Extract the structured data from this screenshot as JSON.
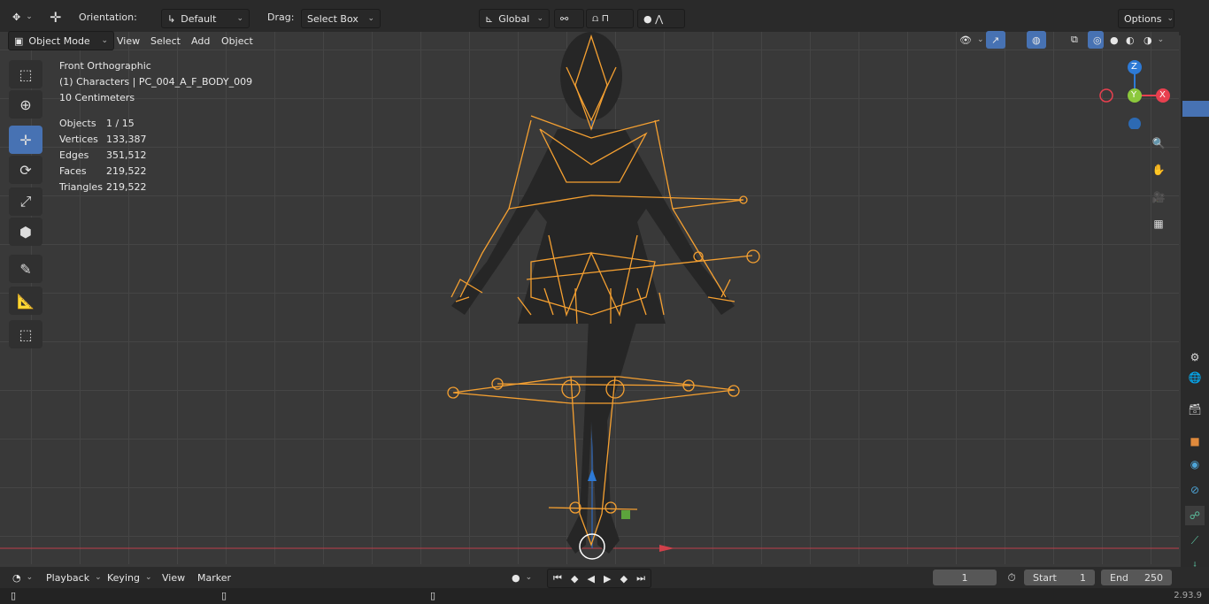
{
  "header": {
    "orientation_label": "Orientation:",
    "orientation_value": "Default",
    "drag_label": "Drag:",
    "drag_value": "Select Box",
    "transform_space": "Global",
    "options_label": "Options"
  },
  "viewport_header": {
    "mode": "Object Mode",
    "menus": [
      "View",
      "Select",
      "Add",
      "Object"
    ]
  },
  "overlay": {
    "view_name": "Front Orthographic",
    "collection": "(1) Characters | PC_004_A_F_BODY_009",
    "grid_scale": "10 Centimeters",
    "stats": [
      {
        "label": "Objects",
        "value": "1 / 15"
      },
      {
        "label": "Vertices",
        "value": "133,387"
      },
      {
        "label": "Edges",
        "value": "351,512"
      },
      {
        "label": "Faces",
        "value": "219,522"
      },
      {
        "label": "Triangles",
        "value": "219,522"
      }
    ]
  },
  "gizmo": {
    "z": "Z",
    "y": "Y",
    "x": "X"
  },
  "timeline": {
    "menus": [
      "Playback",
      "Keying",
      "View",
      "Marker"
    ],
    "current_frame": "1",
    "start_label": "Start",
    "start_value": "1",
    "end_label": "End",
    "end_value": "250"
  },
  "status": {
    "version": "2.93.9"
  },
  "colors": {
    "accent": "#4772b3",
    "bone": "#f5a031",
    "x_axis": "#e8404f",
    "y_axis": "#8cc83c",
    "z_axis": "#2d7ad6"
  }
}
